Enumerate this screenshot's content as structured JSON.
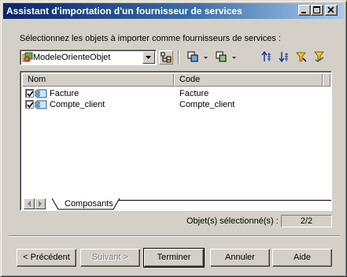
{
  "window": {
    "title": "Assistant d'importation d'un fournisseur de services"
  },
  "prompt": "Sélectionnez les objets à importer comme fournisseurs de services :",
  "model_combo": {
    "selected": "ModeleOrienteObjet"
  },
  "toolbar": {
    "icons": [
      "properties-icon",
      "select-all-icon",
      "filter-icon",
      "move-up-icon",
      "move-down-icon",
      "define-filter-icon",
      "use-filter-icon"
    ]
  },
  "list": {
    "columns": {
      "name": "Nom",
      "code": "Code"
    },
    "rows": [
      {
        "checked": true,
        "name": "Facture",
        "code": "Facture"
      },
      {
        "checked": true,
        "name": "Compte_client",
        "code": "Compte_client"
      }
    ],
    "tab": "Composants"
  },
  "selection": {
    "label": "Objet(s) sélectionné(s) :",
    "count": "2/2"
  },
  "buttons": {
    "previous": "< Précédent",
    "next": "Suivant >",
    "finish": "Terminer",
    "cancel": "Annuler",
    "help": "Aide"
  }
}
